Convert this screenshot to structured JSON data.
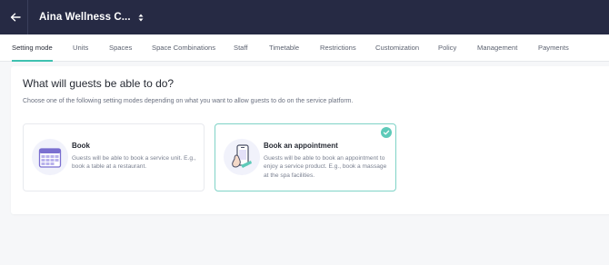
{
  "header": {
    "venue_name": "Aina Wellness C...",
    "back_icon": "arrow-left-icon",
    "switcher_icon": "sort-caret-icon"
  },
  "tabs": [
    {
      "label": "Setting mode",
      "active": true
    },
    {
      "label": "Units"
    },
    {
      "label": "Spaces"
    },
    {
      "label": "Space Combinations"
    },
    {
      "label": "Staff"
    },
    {
      "label": "Timetable"
    },
    {
      "label": "Restrictions"
    },
    {
      "label": "Customization"
    },
    {
      "label": "Policy"
    },
    {
      "label": "Management"
    },
    {
      "label": "Payments"
    }
  ],
  "main": {
    "title": "What will guests be able to do?",
    "subtitle": "Choose one of the following setting modes depending on what you want to allow guests to do on the service platform.",
    "options": [
      {
        "title": "Book",
        "description": "Guests will be able to book a service unit. E.g., book a table at a restaurant.",
        "icon": "calendar-icon",
        "selected": false
      },
      {
        "title": "Book an appointment",
        "description": "Guests will be able to book an appointment to enjoy a service product. E.g., book a massage at the spa facilities.",
        "icon": "phone-booking-icon",
        "selected": true
      }
    ]
  },
  "colors": {
    "topbar": "#262a44",
    "accent": "#3fc1b0",
    "icon_purple": "#7a6fd0"
  }
}
